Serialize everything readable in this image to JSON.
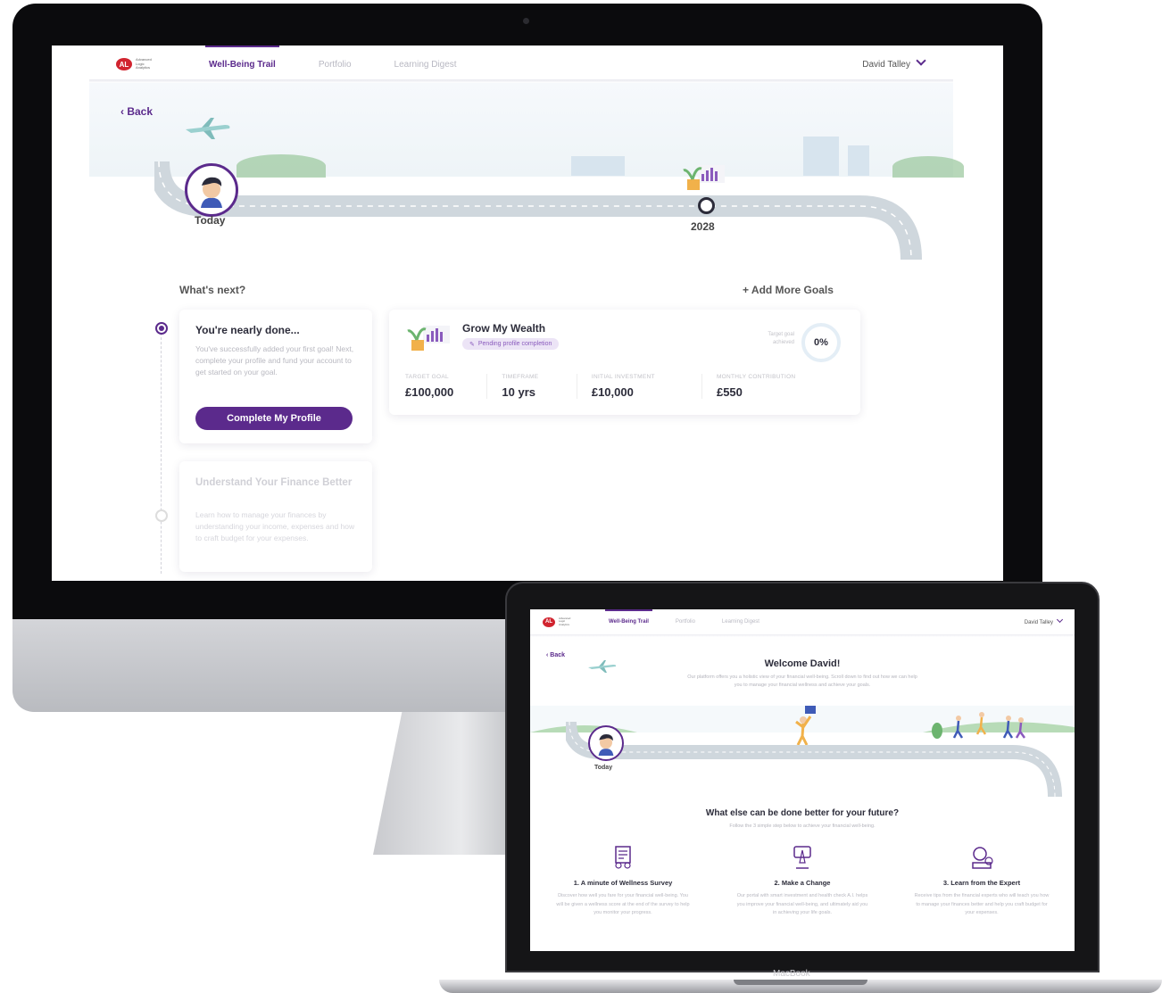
{
  "brand": {
    "logo_mark": "AL",
    "logo_text": "Advanced Logic Analytics",
    "accent": "#5b2a8c",
    "logo_color": "#d1242f"
  },
  "desktop": {
    "nav": {
      "tabs": [
        {
          "label": "Well-Being Trail",
          "active": true
        },
        {
          "label": "Portfolio",
          "active": false
        },
        {
          "label": "Learning Digest",
          "active": false
        }
      ],
      "user": "David Talley"
    },
    "back": "Back",
    "trail": {
      "today": "Today",
      "milestone_year": "2028"
    },
    "whats_next": "What's next?",
    "add_more_goals": "+ Add More Goals",
    "steps": [
      {
        "title": "You're nearly done...",
        "body": "You've successfully added your first goal! Next, complete your profile and fund your account to get started on your goal.",
        "button": "Complete My Profile"
      },
      {
        "title": "Understand Your Finance Better",
        "body": "Learn how to manage your finances by understanding your income, expenses and how to craft budget for your expenses."
      }
    ],
    "goal": {
      "title": "Grow My Wealth",
      "status": "Pending profile completion",
      "achieved_label": "Target goal achieved",
      "achieved_value": "0%",
      "stats": [
        {
          "label": "TARGET GOAL",
          "value": "£100,000"
        },
        {
          "label": "TIMEFRAME",
          "value": "10 yrs"
        },
        {
          "label": "INITIAL INVESTMENT",
          "value": "£10,000"
        },
        {
          "label": "MONTHLY CONTRIBUTION",
          "value": "£550"
        }
      ]
    }
  },
  "laptop": {
    "nav": {
      "tabs": [
        {
          "label": "Well-Being Trail",
          "active": true
        },
        {
          "label": "Portfolio",
          "active": false
        },
        {
          "label": "Learning Digest",
          "active": false
        }
      ],
      "user": "David Talley"
    },
    "back": "Back",
    "welcome_title": "Welcome David!",
    "welcome_text": "Our platform offers you a holistic view of your financial well-being. Scroll down to find out how we can help you to manage your financial wellness and achieve your goals.",
    "today": "Today",
    "section_title": "What else can be done better for your future?",
    "section_sub": "Follow the 3 simple step below to achieve your financial well-being.",
    "features": [
      {
        "title": "1. A minute of Wellness Survey",
        "body": "Discover how well you fare for your financial well-being. You will be given a wellness score at the end of the survey to help you monitor your progress.",
        "icon": "survey-icon"
      },
      {
        "title": "2. Make a Change",
        "body": "Our portal with smart investment and health check A.I. helps you improve your financial well-being, and ultimately aid you in achieving your life goals.",
        "icon": "change-icon"
      },
      {
        "title": "3. Learn from the Expert",
        "body": "Receive tips from the financial experts who will teach you how to manage your finances better and help you craft budget for your expenses.",
        "icon": "expert-icon"
      }
    ],
    "device_label": "MacBook"
  }
}
